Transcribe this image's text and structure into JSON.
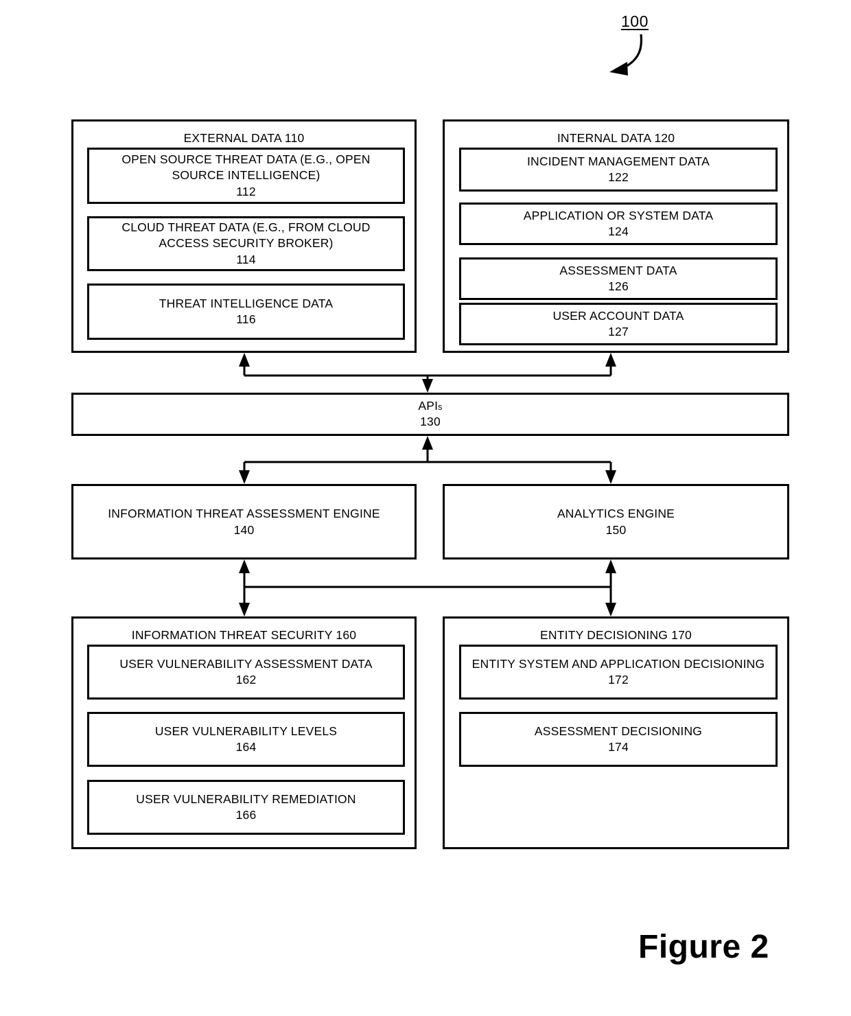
{
  "figure": {
    "system_ref": "100",
    "caption": "Figure 2"
  },
  "external_data": {
    "title": "EXTERNAL DATA 110",
    "items": [
      {
        "label": "OPEN SOURCE THREAT DATA (E.G., OPEN SOURCE INTELLIGENCE)",
        "number": "112"
      },
      {
        "label": "CLOUD THREAT DATA (E.G., FROM CLOUD ACCESS SECURITY BROKER)",
        "number": "114"
      },
      {
        "label": "THREAT INTELLIGENCE DATA",
        "number": "116"
      }
    ]
  },
  "internal_data": {
    "title": "INTERNAL DATA 120",
    "items": [
      {
        "label": "INCIDENT MANAGEMENT DATA",
        "number": "122"
      },
      {
        "label": "APPLICATION OR SYSTEM DATA",
        "number": "124"
      },
      {
        "label": "ASSESSMENT DATA",
        "number": "126"
      },
      {
        "label": "USER ACCOUNT DATA",
        "number": "127"
      }
    ]
  },
  "apis": {
    "label_main": "API",
    "label_sub": "s",
    "number": "130"
  },
  "engines": [
    {
      "label": "INFORMATION THREAT ASSESSMENT ENGINE",
      "number": "140"
    },
    {
      "label": "ANALYTICS ENGINE",
      "number": "150"
    }
  ],
  "information_threat_security": {
    "title": "INFORMATION THREAT SECURITY 160",
    "items": [
      {
        "label": "USER VULNERABILITY ASSESSMENT DATA",
        "number": "162"
      },
      {
        "label": "USER VULNERABILITY LEVELS",
        "number": "164"
      },
      {
        "label": "USER VULNERABILITY REMEDIATION",
        "number": "166"
      }
    ]
  },
  "entity_decisioning": {
    "title": "ENTITY DECISIONING 170",
    "items": [
      {
        "label": "ENTITY SYSTEM AND APPLICATION DECISIONING",
        "number": "172"
      },
      {
        "label": "ASSESSMENT DECISIONING",
        "number": "174"
      }
    ]
  },
  "colors": {
    "stroke": "#000000",
    "background": "#ffffff"
  }
}
